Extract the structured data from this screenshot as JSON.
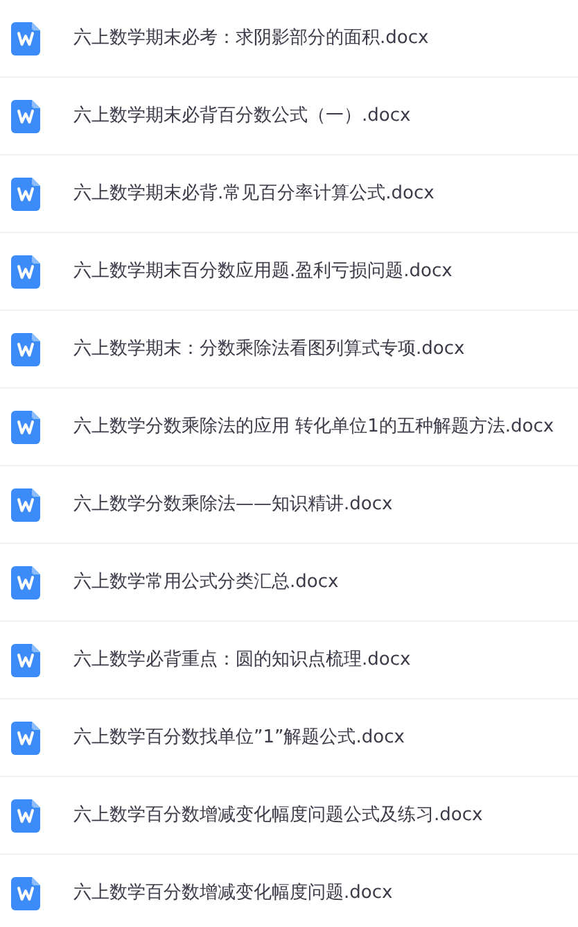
{
  "files": [
    {
      "name": "六上数学期末必考：求阴影部分的面积.docx"
    },
    {
      "name": "六上数学期末必背百分数公式（一）.docx"
    },
    {
      "name": "六上数学期末必背.常见百分率计算公式.docx"
    },
    {
      "name": "六上数学期末百分数应用题.盈利亏损问题.docx"
    },
    {
      "name": "六上数学期末：分数乘除法看图列算式专项.docx"
    },
    {
      "name": "六上数学分数乘除法的应用 转化单位1的五种解题方法.docx"
    },
    {
      "name": "六上数学分数乘除法——知识精讲.docx"
    },
    {
      "name": "六上数学常用公式分类汇总.docx"
    },
    {
      "name": "六上数学必背重点：圆的知识点梳理.docx"
    },
    {
      "name": "六上数学百分数找单位”1”解题公式.docx"
    },
    {
      "name": "六上数学百分数增减变化幅度问题公式及练习.docx"
    },
    {
      "name": "六上数学百分数增减变化幅度问题.docx"
    }
  ]
}
